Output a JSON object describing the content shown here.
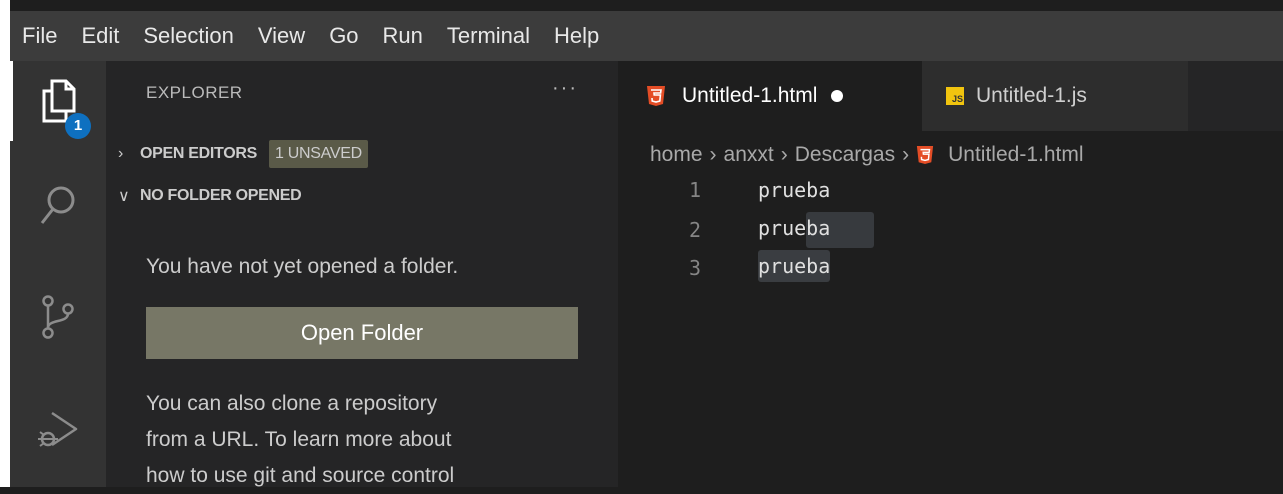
{
  "menu": [
    "File",
    "Edit",
    "Selection",
    "View",
    "Go",
    "Run",
    "Terminal",
    "Help"
  ],
  "activity": {
    "explorer_icon": "files-icon",
    "explorer_badge": "1",
    "search_icon": "search-icon",
    "source_control_icon": "source-control-icon",
    "run_debug_icon": "run-debug-icon"
  },
  "sidebar": {
    "title": "EXPLORER",
    "more": "···",
    "open_editors": {
      "label": "OPEN EDITORS",
      "badge": "1 UNSAVED"
    },
    "no_folder": {
      "label": "NO FOLDER OPENED"
    },
    "message": "You have not yet opened a folder.",
    "open_folder_button": "Open Folder",
    "clone_lines": [
      "You can also clone a repository",
      "from a URL. To learn more about",
      "how to use git and source control"
    ]
  },
  "tabs": [
    {
      "label": "Untitled-1.html",
      "icon": "html5-icon",
      "unsaved": true,
      "active": true
    },
    {
      "label": "Untitled-1.js",
      "icon": "js-icon",
      "active": false
    }
  ],
  "breadcrumb": [
    "home",
    "anxxt",
    "Descargas",
    "Untitled-1.html"
  ],
  "editor": {
    "lines": [
      {
        "number": "1",
        "text": "prueba"
      },
      {
        "number": "2",
        "text": "prueba"
      },
      {
        "number": "3",
        "text": "prueba"
      }
    ]
  },
  "colors": {
    "menubar": "#3c3c3c",
    "activitybar": "#333333",
    "sidebar": "#252526",
    "editor": "#1e1e1e",
    "badge": "#0e70c0",
    "html_icon": "#e44d26",
    "js_icon": "#f1c40f"
  }
}
